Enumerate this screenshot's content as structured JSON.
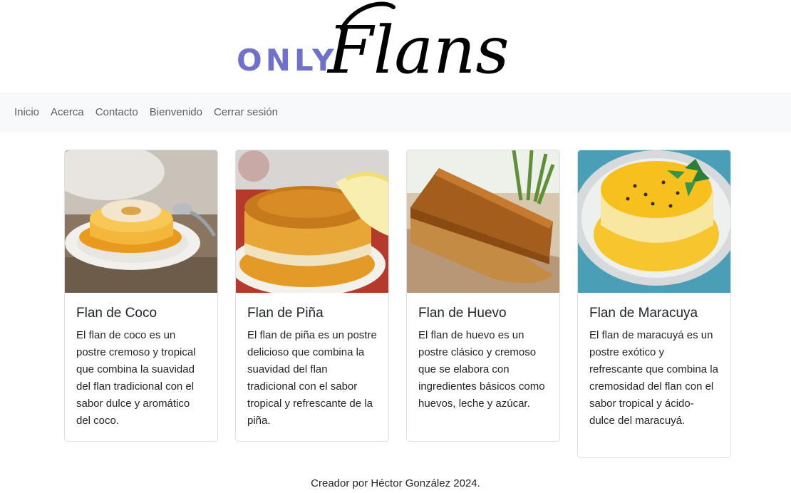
{
  "logo": {
    "prefix": "ONLY",
    "wordmark": "Flans",
    "prefix_color": "#6f72c8"
  },
  "nav": {
    "items": [
      "Inicio",
      "Acerca",
      "Contacto",
      "Bienvenido",
      "Cerrar sesión"
    ]
  },
  "cards": [
    {
      "title": "Flan de Coco",
      "text": "El flan de coco es un postre cremoso y tropical que combina la suavidad del flan tradicional con el sabor dulce y aromático del coco.",
      "image": "coconut-flan-photo"
    },
    {
      "title": "Flan de Piña",
      "text": "El flan de piña es un postre delicioso que combina la suavidad del flan tradicional con el sabor tropical y refrescante de la piña.",
      "image": "pineapple-flan-photo"
    },
    {
      "title": "Flan de Huevo",
      "text": "El flan de huevo es un postre clásico y cremoso que se elabora con ingredientes básicos como huevos, leche y azúcar.",
      "image": "egg-flan-photo"
    },
    {
      "title": "Flan de Maracuya",
      "text": "El flan de maracuyá es un postre exótico y refrescante que combina la cremosidad del flan con el sabor tropical y ácido-dulce del maracuyá.",
      "image": "passionfruit-flan-photo"
    }
  ],
  "footer": {
    "text": "Creador por Héctor González 2024."
  }
}
